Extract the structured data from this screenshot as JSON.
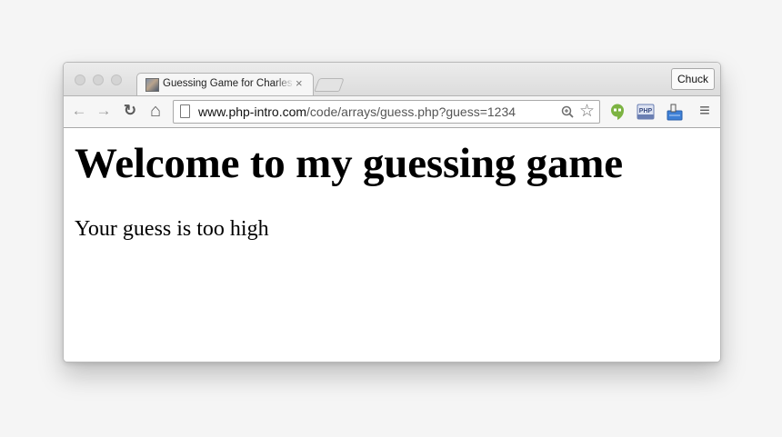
{
  "browser": {
    "tab": {
      "title": "Guessing Game for Charles",
      "close_glyph": "×",
      "favicon": "profile-photo-icon"
    },
    "profile_button": "Chuck",
    "toolbar": {
      "back_glyph": "←",
      "forward_glyph": "→",
      "reload_glyph": "↻",
      "home_glyph": "⌂",
      "menu_glyph": "≡"
    },
    "address_bar": {
      "host": "www.php-intro.com",
      "path": "/code/arrays/guess.php?guess=1234"
    },
    "extensions": [
      {
        "name": "hangouts-icon",
        "color": "#7cb342"
      },
      {
        "name": "php-extension-icon",
        "label": "PHP",
        "color": "#6b7fb3"
      },
      {
        "name": "clipboard-extension-icon",
        "color": "#3d7fd6"
      }
    ]
  },
  "page": {
    "heading": "Welcome to my guessing game",
    "message": "Your guess is too high"
  }
}
